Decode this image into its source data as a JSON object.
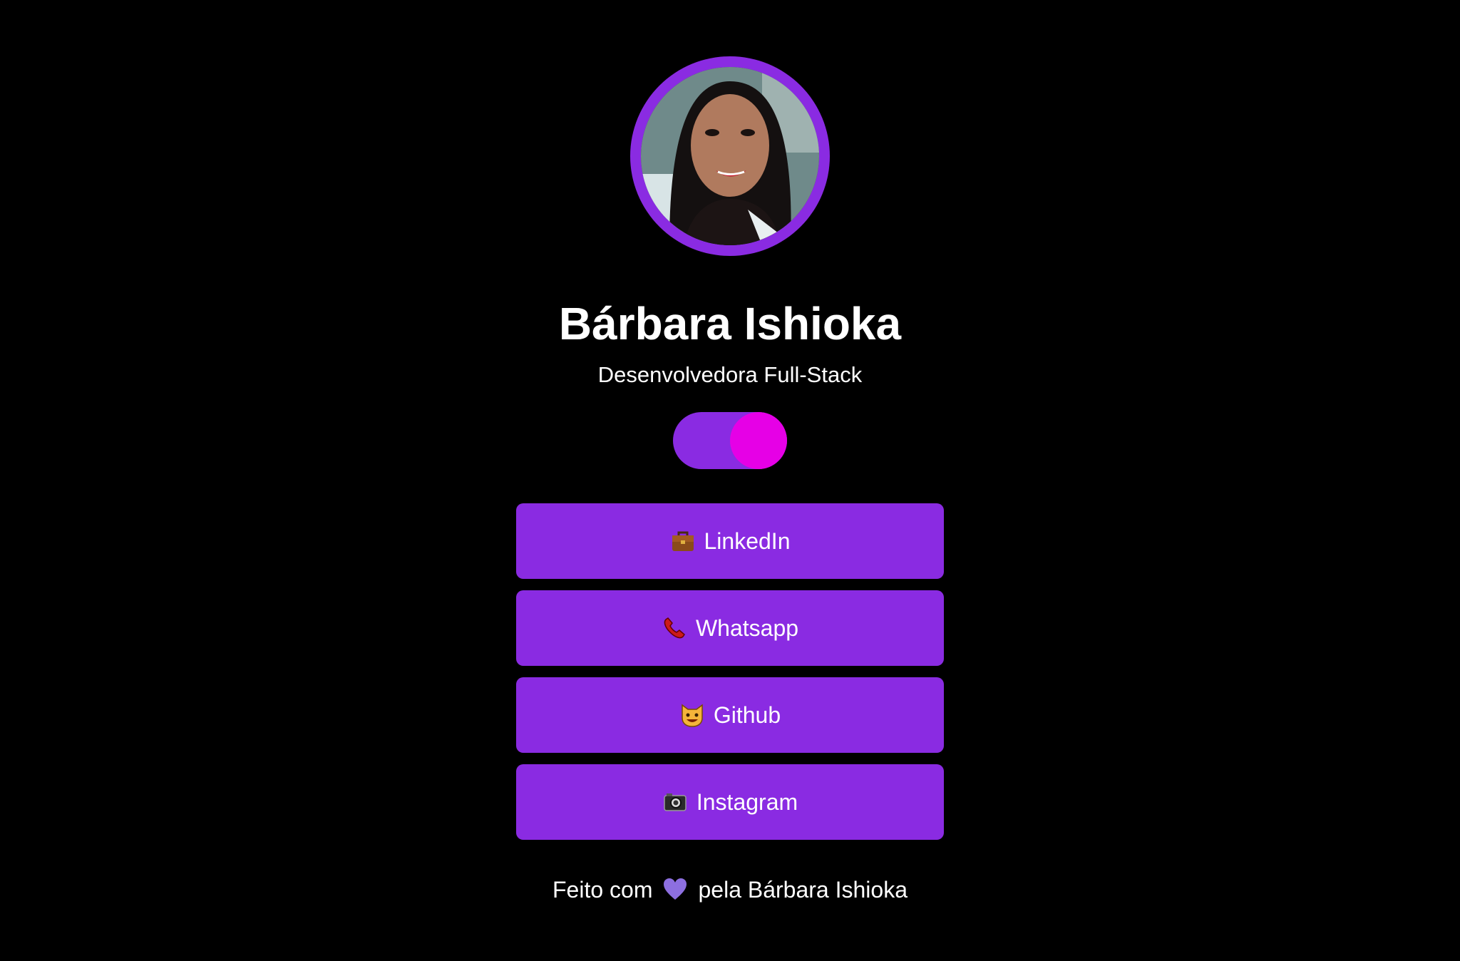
{
  "profile": {
    "name": "Bárbara Ishioka",
    "role": "Desenvolvedora Full-Stack",
    "avatar_icon": "profile-photo"
  },
  "theme_toggle": {
    "state": "on",
    "track_color": "#8a2be2",
    "knob_color": "#e600e6"
  },
  "links": [
    {
      "label": "LinkedIn",
      "icon": "briefcase-icon"
    },
    {
      "label": "Whatsapp",
      "icon": "telephone-receiver-icon"
    },
    {
      "label": "Github",
      "icon": "grinning-cat-icon"
    },
    {
      "label": "Instagram",
      "icon": "camera-icon"
    }
  ],
  "footer": {
    "prefix": "Feito com",
    "heart_icon": "purple-heart-icon",
    "suffix": "pela Bárbara Ishioka"
  },
  "colors": {
    "background": "#000000",
    "accent": "#8a2be2",
    "text": "#ffffff"
  }
}
